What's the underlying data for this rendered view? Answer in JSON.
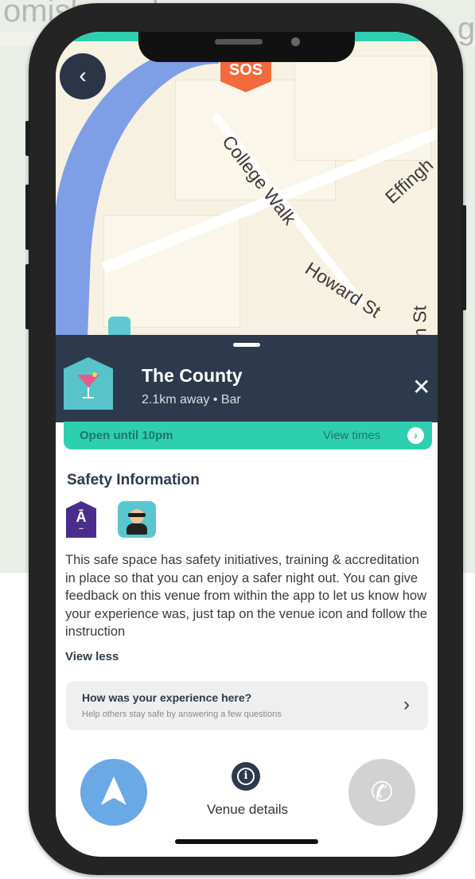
{
  "backdrop": {
    "text_top": "omisbound",
    "text_right": "g"
  },
  "map": {
    "sos_label": "SOS",
    "back_icon": "chevron-left-icon",
    "streets": [
      "College Walk",
      "Howard St",
      "Effingh",
      "m St"
    ]
  },
  "venue": {
    "name": "The County",
    "meta": "2.1km away • Bar",
    "close_icon": "close-icon"
  },
  "hours": {
    "open_text": "Open until 10pm",
    "view_times_label": "View times"
  },
  "safety": {
    "title": "Safety Information",
    "badges": [
      "ask-angela-badge",
      "bouncer-badge"
    ],
    "description": "This safe space has safety initiatives, training & accreditation in place so that you can enjoy a safer night out. You can give feedback on this venue from within the app to let us know how your experience was, just tap on the venue icon and follow the instruction",
    "view_less_label": "View less"
  },
  "feedback": {
    "title": "How was your experience here?",
    "subtitle": "Help others stay safe by answering a few questions"
  },
  "actions": {
    "venue_details_label": "Venue details"
  },
  "colors": {
    "accent_teal": "#2ecfb0",
    "header_navy": "#2d3a4d",
    "sos_orange": "#f26a3d",
    "navigate_blue": "#6aa9e6",
    "call_grey": "#d2d2d2"
  }
}
